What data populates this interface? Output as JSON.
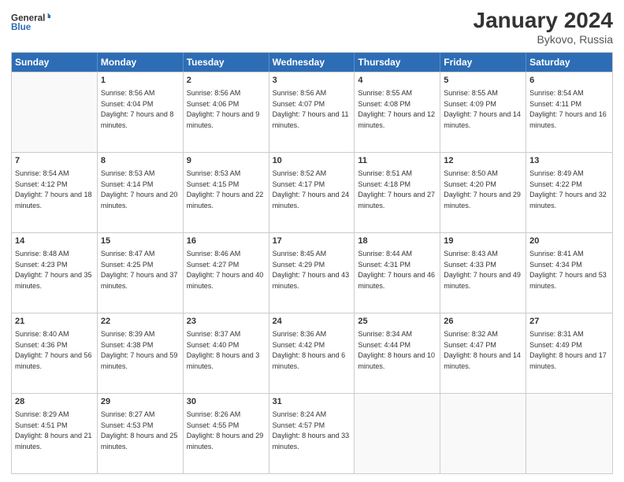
{
  "logo": {
    "general": "General",
    "blue": "Blue"
  },
  "title": "January 2024",
  "subtitle": "Bykovo, Russia",
  "headers": [
    "Sunday",
    "Monday",
    "Tuesday",
    "Wednesday",
    "Thursday",
    "Friday",
    "Saturday"
  ],
  "rows": [
    [
      {
        "day": "",
        "sunrise": "",
        "sunset": "",
        "daylight": ""
      },
      {
        "day": "1",
        "sunrise": "8:56 AM",
        "sunset": "4:04 PM",
        "daylight": "7 hours and 8 minutes."
      },
      {
        "day": "2",
        "sunrise": "8:56 AM",
        "sunset": "4:06 PM",
        "daylight": "7 hours and 9 minutes."
      },
      {
        "day": "3",
        "sunrise": "8:56 AM",
        "sunset": "4:07 PM",
        "daylight": "7 hours and 11 minutes."
      },
      {
        "day": "4",
        "sunrise": "8:55 AM",
        "sunset": "4:08 PM",
        "daylight": "7 hours and 12 minutes."
      },
      {
        "day": "5",
        "sunrise": "8:55 AM",
        "sunset": "4:09 PM",
        "daylight": "7 hours and 14 minutes."
      },
      {
        "day": "6",
        "sunrise": "8:54 AM",
        "sunset": "4:11 PM",
        "daylight": "7 hours and 16 minutes."
      }
    ],
    [
      {
        "day": "7",
        "sunrise": "8:54 AM",
        "sunset": "4:12 PM",
        "daylight": "7 hours and 18 minutes."
      },
      {
        "day": "8",
        "sunrise": "8:53 AM",
        "sunset": "4:14 PM",
        "daylight": "7 hours and 20 minutes."
      },
      {
        "day": "9",
        "sunrise": "8:53 AM",
        "sunset": "4:15 PM",
        "daylight": "7 hours and 22 minutes."
      },
      {
        "day": "10",
        "sunrise": "8:52 AM",
        "sunset": "4:17 PM",
        "daylight": "7 hours and 24 minutes."
      },
      {
        "day": "11",
        "sunrise": "8:51 AM",
        "sunset": "4:18 PM",
        "daylight": "7 hours and 27 minutes."
      },
      {
        "day": "12",
        "sunrise": "8:50 AM",
        "sunset": "4:20 PM",
        "daylight": "7 hours and 29 minutes."
      },
      {
        "day": "13",
        "sunrise": "8:49 AM",
        "sunset": "4:22 PM",
        "daylight": "7 hours and 32 minutes."
      }
    ],
    [
      {
        "day": "14",
        "sunrise": "8:48 AM",
        "sunset": "4:23 PM",
        "daylight": "7 hours and 35 minutes."
      },
      {
        "day": "15",
        "sunrise": "8:47 AM",
        "sunset": "4:25 PM",
        "daylight": "7 hours and 37 minutes."
      },
      {
        "day": "16",
        "sunrise": "8:46 AM",
        "sunset": "4:27 PM",
        "daylight": "7 hours and 40 minutes."
      },
      {
        "day": "17",
        "sunrise": "8:45 AM",
        "sunset": "4:29 PM",
        "daylight": "7 hours and 43 minutes."
      },
      {
        "day": "18",
        "sunrise": "8:44 AM",
        "sunset": "4:31 PM",
        "daylight": "7 hours and 46 minutes."
      },
      {
        "day": "19",
        "sunrise": "8:43 AM",
        "sunset": "4:33 PM",
        "daylight": "7 hours and 49 minutes."
      },
      {
        "day": "20",
        "sunrise": "8:41 AM",
        "sunset": "4:34 PM",
        "daylight": "7 hours and 53 minutes."
      }
    ],
    [
      {
        "day": "21",
        "sunrise": "8:40 AM",
        "sunset": "4:36 PM",
        "daylight": "7 hours and 56 minutes."
      },
      {
        "day": "22",
        "sunrise": "8:39 AM",
        "sunset": "4:38 PM",
        "daylight": "7 hours and 59 minutes."
      },
      {
        "day": "23",
        "sunrise": "8:37 AM",
        "sunset": "4:40 PM",
        "daylight": "8 hours and 3 minutes."
      },
      {
        "day": "24",
        "sunrise": "8:36 AM",
        "sunset": "4:42 PM",
        "daylight": "8 hours and 6 minutes."
      },
      {
        "day": "25",
        "sunrise": "8:34 AM",
        "sunset": "4:44 PM",
        "daylight": "8 hours and 10 minutes."
      },
      {
        "day": "26",
        "sunrise": "8:32 AM",
        "sunset": "4:47 PM",
        "daylight": "8 hours and 14 minutes."
      },
      {
        "day": "27",
        "sunrise": "8:31 AM",
        "sunset": "4:49 PM",
        "daylight": "8 hours and 17 minutes."
      }
    ],
    [
      {
        "day": "28",
        "sunrise": "8:29 AM",
        "sunset": "4:51 PM",
        "daylight": "8 hours and 21 minutes."
      },
      {
        "day": "29",
        "sunrise": "8:27 AM",
        "sunset": "4:53 PM",
        "daylight": "8 hours and 25 minutes."
      },
      {
        "day": "30",
        "sunrise": "8:26 AM",
        "sunset": "4:55 PM",
        "daylight": "8 hours and 29 minutes."
      },
      {
        "day": "31",
        "sunrise": "8:24 AM",
        "sunset": "4:57 PM",
        "daylight": "8 hours and 33 minutes."
      },
      {
        "day": "",
        "sunrise": "",
        "sunset": "",
        "daylight": ""
      },
      {
        "day": "",
        "sunrise": "",
        "sunset": "",
        "daylight": ""
      },
      {
        "day": "",
        "sunrise": "",
        "sunset": "",
        "daylight": ""
      }
    ]
  ]
}
